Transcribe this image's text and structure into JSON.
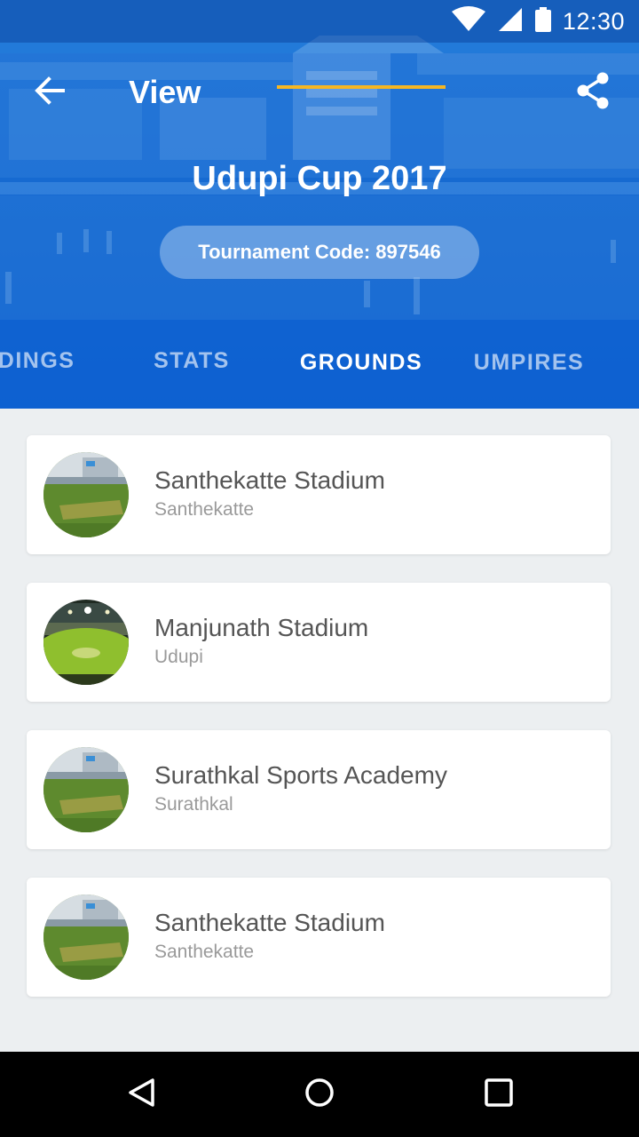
{
  "status_bar": {
    "time": "12:30",
    "icons": [
      "wifi-icon",
      "signal-icon",
      "battery-icon"
    ]
  },
  "toolbar": {
    "back_icon": "arrow-left-icon",
    "title": "View",
    "share_icon": "share-icon"
  },
  "tournament": {
    "name": "Udupi Cup 2017",
    "code_label": "Tournament Code: 897546"
  },
  "tabs": [
    {
      "label": "STANDINGS",
      "active": false
    },
    {
      "label": "STATS",
      "active": false
    },
    {
      "label": "GROUNDS",
      "active": true
    },
    {
      "label": "UMPIRES",
      "active": false
    }
  ],
  "grounds": [
    {
      "name": "Santhekatte Stadium",
      "city": "Santhekatte",
      "thumb": "ground-day"
    },
    {
      "name": "Manjunath Stadium",
      "city": "Udupi",
      "thumb": "stadium-night"
    },
    {
      "name": "Surathkal Sports Academy",
      "city": "Surathkal",
      "thumb": "ground-day"
    },
    {
      "name": "Santhekatte Stadium",
      "city": "Santhekatte",
      "thumb": "ground-day"
    }
  ],
  "nav_bar": {
    "icons": [
      "back-triangle-icon",
      "home-circle-icon",
      "recents-square-icon"
    ]
  },
  "colors": {
    "header_blue": "#1568d0",
    "tab_indicator": "#f5b623",
    "background": "#eceff1",
    "card": "#ffffff",
    "title_text": "#555555",
    "subtitle_text": "#9a9a9a"
  }
}
